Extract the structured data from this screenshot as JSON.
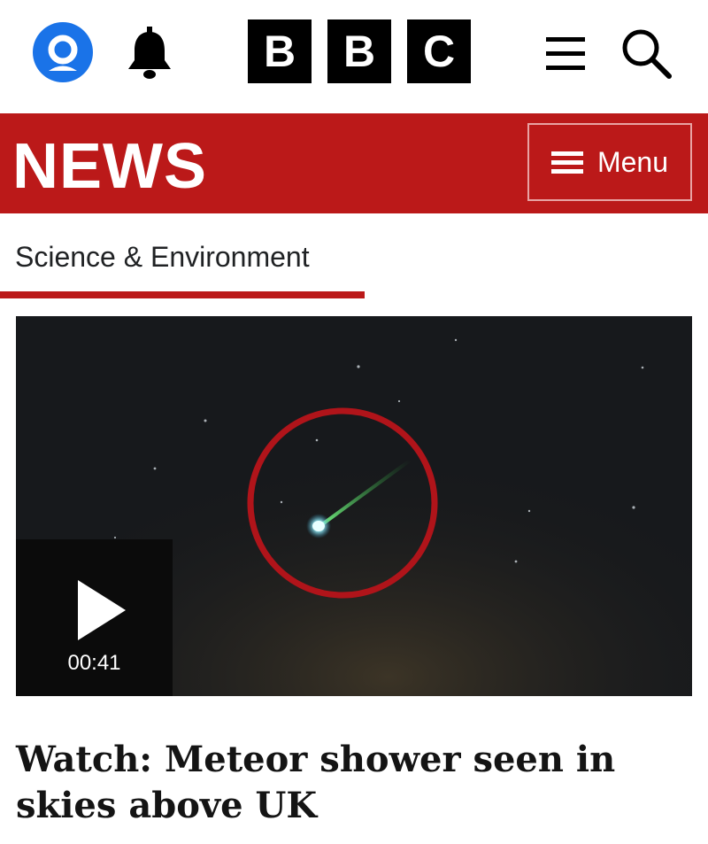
{
  "header": {
    "account_icon": "account-icon",
    "notification_icon": "bell-icon",
    "logo_letters": [
      "B",
      "B",
      "C"
    ],
    "menu_icon": "hamburger-icon",
    "search_icon": "search-icon"
  },
  "news_banner": {
    "title": "NEWS",
    "menu_label": "Menu",
    "background_color": "#bb1919"
  },
  "section": {
    "label": "Science & Environment",
    "accent_color": "#bb1919"
  },
  "video": {
    "duration": "00:41",
    "play_icon": "play-icon"
  },
  "article": {
    "headline": "Watch: Meteor shower seen in skies above UK"
  }
}
